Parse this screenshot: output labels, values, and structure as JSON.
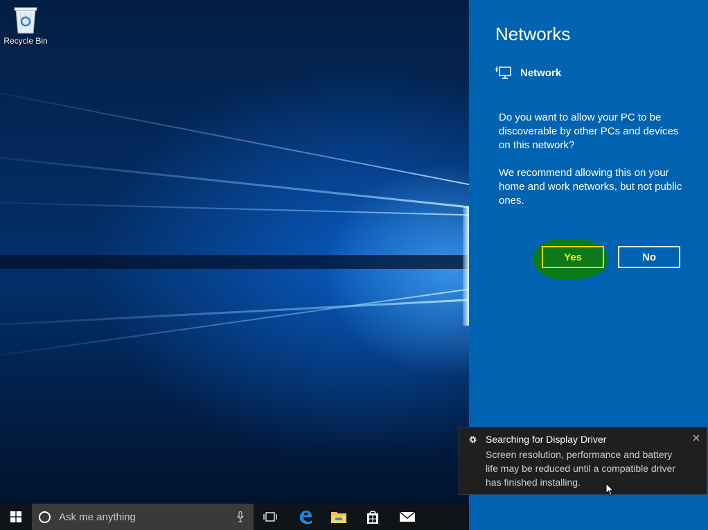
{
  "desktop": {
    "icons": [
      {
        "label": "Recycle Bin",
        "icon": "recycle-bin-icon"
      }
    ]
  },
  "flyout": {
    "title": "Networks",
    "network": {
      "icon": "wired-network-icon",
      "name": "Network"
    },
    "question": "Do you want to allow your PC to be discoverable by other PCs and devices on this network?",
    "recommendation": "We recommend allowing this on your home and work networks, but not public ones.",
    "yes_label": "Yes",
    "no_label": "No",
    "background": "#0063b1",
    "highlight_color": "#0d7a1a",
    "highlight_border": "#ffd800"
  },
  "toast": {
    "icon": "gear-icon",
    "title": "Searching for Display Driver",
    "body": "Screen resolution, performance and battery life may be reduced until a compatible driver has finished installing.",
    "close_icon": "close-icon"
  },
  "taskbar": {
    "search_placeholder": "Ask me anything",
    "items": [
      "task-view-icon",
      "edge-icon",
      "file-explorer-icon",
      "store-icon",
      "mail-icon"
    ]
  }
}
